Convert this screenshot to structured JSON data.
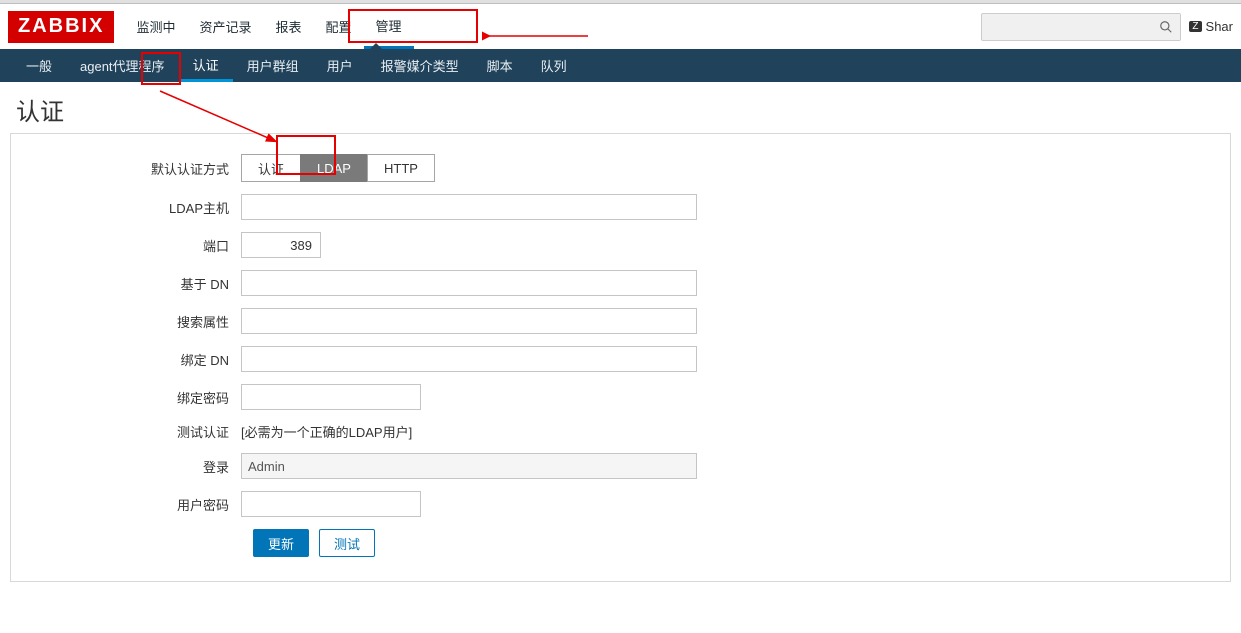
{
  "brand": "ZABBIX",
  "top_menu": [
    "监测中",
    "资产记录",
    "报表",
    "配置",
    "管理"
  ],
  "top_menu_active_index": 4,
  "share_label": "Shar",
  "subnav": [
    "一般",
    "agent代理程序",
    "认证",
    "用户群组",
    "用户",
    "报警媒介类型",
    "脚本",
    "队列"
  ],
  "subnav_active_index": 2,
  "page_heading": "认证",
  "form": {
    "method_label": "默认认证方式",
    "method_options": [
      "认证",
      "LDAP",
      "HTTP"
    ],
    "method_active_index": 1,
    "ldap_host_label": "LDAP主机",
    "ldap_host_value": "",
    "port_label": "端口",
    "port_value": "389",
    "base_dn_label": "基于 DN",
    "base_dn_value": "",
    "search_attr_label": "搜索属性",
    "search_attr_value": "",
    "bind_dn_label": "绑定 DN",
    "bind_dn_value": "",
    "bind_pw_label": "绑定密码",
    "bind_pw_value": "",
    "test_auth_label": "测试认证",
    "test_auth_note": "[必需为一个正确的LDAP用户]",
    "login_label": "登录",
    "login_value": "Admin",
    "user_pw_label": "用户密码",
    "user_pw_value": "",
    "btn_update": "更新",
    "btn_test": "测试"
  }
}
